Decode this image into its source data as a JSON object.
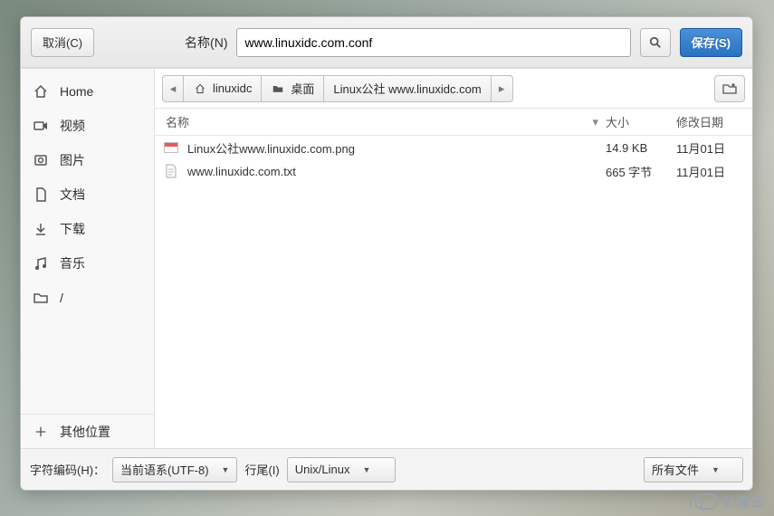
{
  "topbar": {
    "cancel": "取消(C)",
    "name_label": "名称(N)",
    "filename": "www.linuxidc.com.conf",
    "save": "保存(S)"
  },
  "sidebar": {
    "items": [
      {
        "icon": "home-icon",
        "label": "Home"
      },
      {
        "icon": "video-icon",
        "label": "视频"
      },
      {
        "icon": "image-icon",
        "label": "图片"
      },
      {
        "icon": "document-icon",
        "label": "文档"
      },
      {
        "icon": "download-icon",
        "label": "下载"
      },
      {
        "icon": "music-icon",
        "label": "音乐"
      },
      {
        "icon": "folder-icon",
        "label": "/"
      }
    ],
    "other": "其他位置"
  },
  "path": {
    "seg0": "linuxidc",
    "seg1": "桌面",
    "seg2": "Linux公社  www.linuxidc.com"
  },
  "columns": {
    "name": "名称",
    "size": "大小",
    "modified": "修改日期"
  },
  "files": [
    {
      "name": "Linux公社www.linuxidc.com.png",
      "size": "14.9 KB",
      "modified": "11月01日",
      "type": "image"
    },
    {
      "name": "www.linuxidc.com.txt",
      "size": "665  字节",
      "modified": "11月01日",
      "type": "text"
    }
  ],
  "bottom": {
    "enc_label": "字符编码(H)：",
    "encoding": "当前语系(UTF-8)",
    "line_label": "行尾(I)",
    "line_ending": "Unix/Linux",
    "filter": "所有文件"
  },
  "watermark": "亿速云"
}
